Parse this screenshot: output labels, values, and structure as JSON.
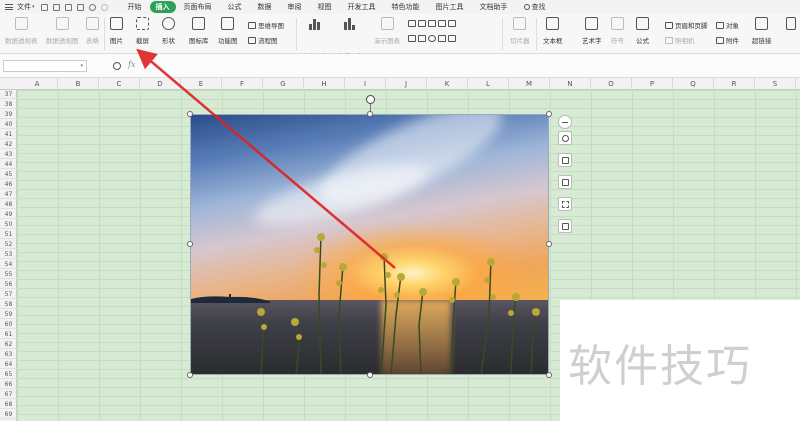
{
  "menubar": {
    "file_label": "文件",
    "tabs": [
      "开始",
      "插入",
      "页面布局",
      "公式",
      "数据",
      "审阅",
      "视图",
      "开发工具",
      "特色功能",
      "图片工具",
      "文档助手"
    ],
    "active_tab": "插入",
    "search_label": "查找"
  },
  "ribbon": {
    "pivot_table": "数据透视表",
    "pivot_chart": "数据透视图",
    "table": "表格",
    "picture": "图片",
    "screenshot": "截屏",
    "shapes": "形状",
    "icon_lib": "图标库",
    "func_chart": "功能图",
    "mind_map": "思维导图",
    "flow_chart": "流程图",
    "all_charts": "全部图表",
    "online_charts": "在线图表",
    "demo_chart": "演示图表",
    "slicer": "切片器",
    "text_box": "文本框",
    "word_art": "艺术字",
    "symbol": "符号",
    "formula": "公式",
    "header_footer": "页眉和页脚",
    "camera": "照相机",
    "object": "对象",
    "attachment": "附件",
    "hyperlink": "超链接"
  },
  "formula_bar": {
    "name_box_value": "",
    "fx_label": "fx",
    "formula_value": ""
  },
  "columns": [
    "A",
    "B",
    "C",
    "D",
    "E",
    "F",
    "G",
    "H",
    "I",
    "J",
    "K",
    "L",
    "M",
    "N",
    "O",
    "P",
    "Q",
    "R",
    "S"
  ],
  "rows": [
    "37",
    "38",
    "39",
    "40",
    "41",
    "42",
    "43",
    "44",
    "45",
    "46",
    "47",
    "48",
    "49",
    "50",
    "51",
    "52",
    "53",
    "54",
    "55",
    "56",
    "57",
    "58",
    "59",
    "60",
    "61",
    "62",
    "63",
    "64",
    "65",
    "66",
    "67",
    "68",
    "69"
  ],
  "watermark": "软件技巧",
  "colors": {
    "accent": "#2e9f5a",
    "grid_bg": "#d7ead4",
    "arrow": "#e02020"
  }
}
